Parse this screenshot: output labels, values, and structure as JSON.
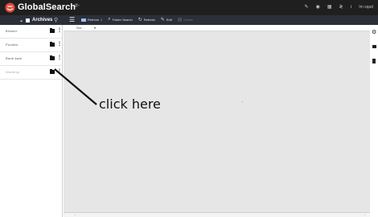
{
  "app": {
    "name": "GlobalSearch",
    "brand_extra": "#-",
    "user": "Im sqad"
  },
  "topbar_icons": [
    "wrench-icon",
    "globe-icon",
    "grid-icon",
    "code-icon",
    "info-icon"
  ],
  "toolbar": {
    "archives_label": "Archives",
    "items": [
      {
        "label": "Refresh",
        "badge": "2",
        "icon": "folder-icon"
      },
      {
        "label": "Folder Search",
        "icon": "search-folder-icon"
      },
      {
        "label": "Refresh",
        "icon": "refresh-icon"
      },
      {
        "label": "Edit",
        "icon": "pencil-icon"
      },
      {
        "label": "Delete",
        "icon": "trash-icon",
        "disabled": true
      }
    ]
  },
  "sidebar": {
    "items": [
      {
        "label": "Bilaner"
      },
      {
        "label": "Pundes"
      },
      {
        "label": "Bank kaar"
      },
      {
        "label": "Waldesp",
        "muted": true
      }
    ]
  },
  "main": {
    "sort_label": "Sor..."
  },
  "annotation": {
    "text": "click here"
  },
  "colors": {
    "topbar": "#1f1f1f",
    "toolbar": "#2a2f38",
    "content_bg": "#e6e6e6",
    "accent": "#9fc0ff",
    "logo": "#e24a3b"
  }
}
